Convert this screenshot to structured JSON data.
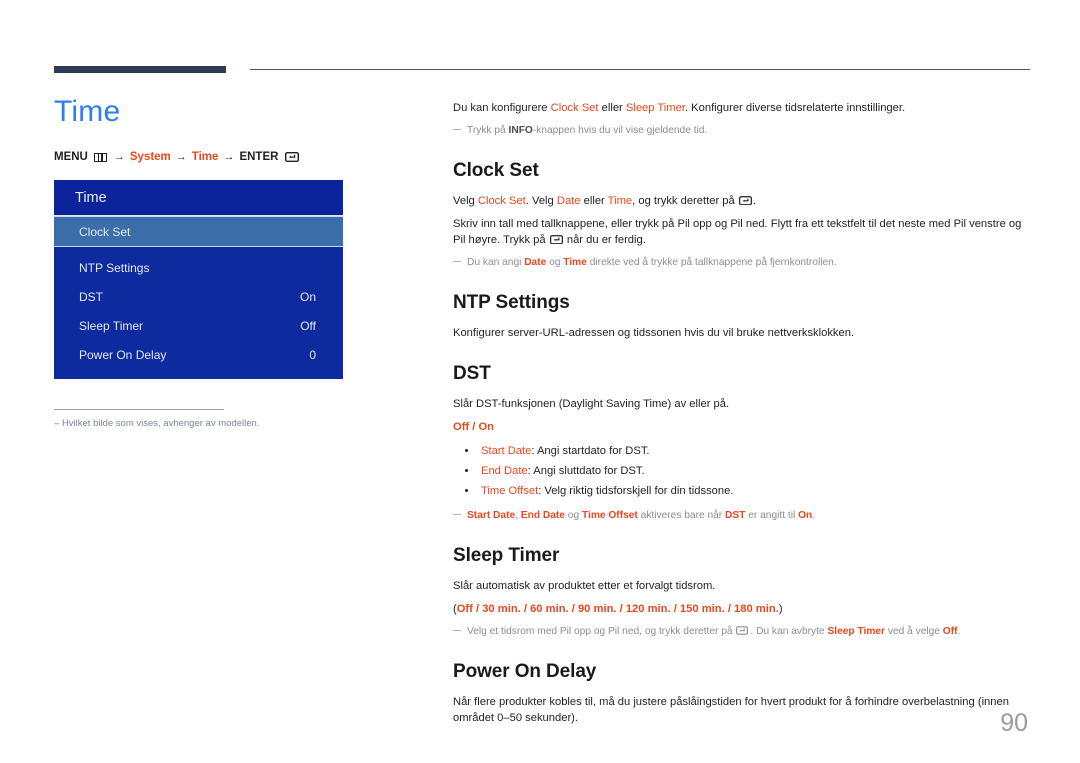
{
  "page": {
    "number": "90",
    "title": "Time"
  },
  "breadcrumb": {
    "menu_label": "MENU",
    "menu_icon": "menu-grid-icon",
    "arrow": "→",
    "step1": "System",
    "step2": "Time",
    "enter_label": "ENTER",
    "enter_icon": "enter-key-icon"
  },
  "osd": {
    "header": "Time",
    "rows": [
      {
        "label": "Clock Set",
        "value": "",
        "selected": true
      },
      {
        "label": "NTP Settings",
        "value": "",
        "selected": false
      },
      {
        "label": "DST",
        "value": "On",
        "selected": false
      },
      {
        "label": "Sleep Timer",
        "value": "Off",
        "selected": false
      },
      {
        "label": "Power On Delay",
        "value": "0",
        "selected": false
      }
    ]
  },
  "left_note": "Hvilket bilde som vises, avhenger av modellen.",
  "intro": {
    "t1": "Du kan konfigurere ",
    "k1": "Clock Set",
    "t2": " eller ",
    "k2": "Sleep Timer",
    "t3": ". Konfigurer diverse tidsrelaterte innstillinger.",
    "note_t1": "Trykk på ",
    "note_k1": "INFO",
    "note_t2": "-knappen hvis du vil vise gjeldende tid."
  },
  "clock_set": {
    "heading": "Clock Set",
    "p1_t1": "Velg ",
    "p1_k1": "Clock Set",
    "p1_t2": ". Velg ",
    "p1_k2": "Date",
    "p1_t3": " eller ",
    "p1_k3": "Time",
    "p1_t4": ", og trykk deretter på ",
    "p1_t5": ".",
    "p2_t1": "Skriv inn tall med tallknappene, eller trykk på Pil opp og Pil ned. Flytt fra ett tekstfelt til det neste med Pil venstre og Pil høyre. Trykk på ",
    "p2_t2": " når du er ferdig.",
    "note_t1": "Du kan angi ",
    "note_k1": "Date",
    "note_t2": " og ",
    "note_k2": "Time",
    "note_t3": " direkte ved å trykke på tallknappene på fjernkontrollen."
  },
  "ntp": {
    "heading": "NTP Settings",
    "p1": "Konfigurer server-URL-adressen og tidssonen hvis du vil bruke nettverksklokken."
  },
  "dst": {
    "heading": "DST",
    "p1": "Slår DST-funksjonen (Daylight Saving Time) av eller på.",
    "options": "Off / On",
    "bullets": [
      {
        "key": "Start Date",
        "text": ": Angi startdato for DST."
      },
      {
        "key": "End Date",
        "text": ": Angi sluttdato for DST."
      },
      {
        "key": "Time Offset",
        "text": ": Velg riktig tidsforskjell for din tidssone."
      }
    ],
    "note_k1": "Start Date",
    "note_t1": ", ",
    "note_k2": "End Date",
    "note_t2": " og ",
    "note_k3": "Time Offset",
    "note_t3": " aktiveres bare når ",
    "note_k4": "DST",
    "note_t4": " er angitt til ",
    "note_k5": "On",
    "note_t5": "."
  },
  "sleep_timer": {
    "heading": "Sleep Timer",
    "p1": "Slår automatisk av produktet etter et forvalgt tidsrom.",
    "options_open": "(",
    "options": "Off / 30 min. / 60 min. / 90 min. / 120 min. / 150 min. / 180 min.",
    "options_close": ")",
    "note_t1": "Velg et tidsrom med Pil opp og Pil ned, og trykk deretter på ",
    "note_t2": ". Du kan avbryte ",
    "note_k1": "Sleep Timer",
    "note_t3": " ved å velge ",
    "note_k2": "Off",
    "note_t4": "."
  },
  "power_on_delay": {
    "heading": "Power On Delay",
    "p1": "Når flere produkter kobles til, må du justere påslåingstiden for hvert produkt for å forhindre overbelastning (innen området 0–50 sekunder)."
  },
  "colors": {
    "accent_blue": "#2d7ff0",
    "accent_red": "#e8481c",
    "osd_blue": "#0d2b9e",
    "osd_selected": "#3b6ea8",
    "rule_navy": "#2f3b55"
  }
}
